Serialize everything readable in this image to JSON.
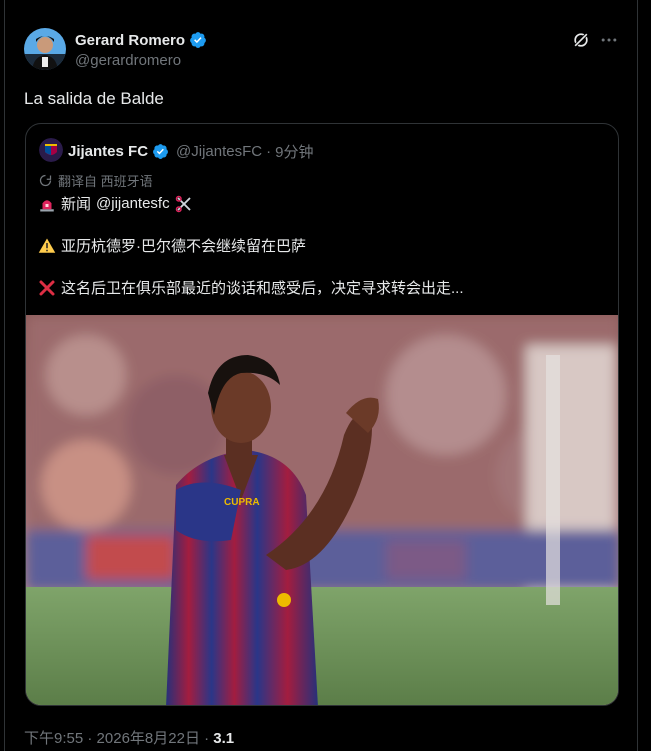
{
  "author": {
    "name": "Gerard Romero",
    "handle": "@gerardromero",
    "verified": true,
    "avatar_icon": "avatar-photo"
  },
  "tweet": {
    "text": "La salida de Balde"
  },
  "quote": {
    "name": "Jijantes FC",
    "handle": "@JijantesFC",
    "separator": "·",
    "time": "9分钟",
    "translated_label": "翻译自 西班牙语",
    "line1_prefix": "新闻",
    "line1_mention": "@jijantesfc",
    "line2": "亚历杭德罗·巴尔德不会继续留在巴萨",
    "line3": "这名后卫在俱乐部最近的谈话和感受后，决定寻求转会出走..."
  },
  "meta": {
    "time": "下午9:55",
    "separator": "·",
    "date": "2026年8月22日",
    "views_visible": "3.1"
  },
  "colors": {
    "background": "#000000",
    "text_primary": "#e7e9ea",
    "text_secondary": "#71767b",
    "border": "#2f3336",
    "verified_blue": "#1d9bf0"
  },
  "icons": [
    "verified-badge-icon",
    "grok-icon",
    "more-icon",
    "translate-icon",
    "siren-icon",
    "scissors-icon",
    "warning-icon",
    "cross-mark-icon"
  ]
}
